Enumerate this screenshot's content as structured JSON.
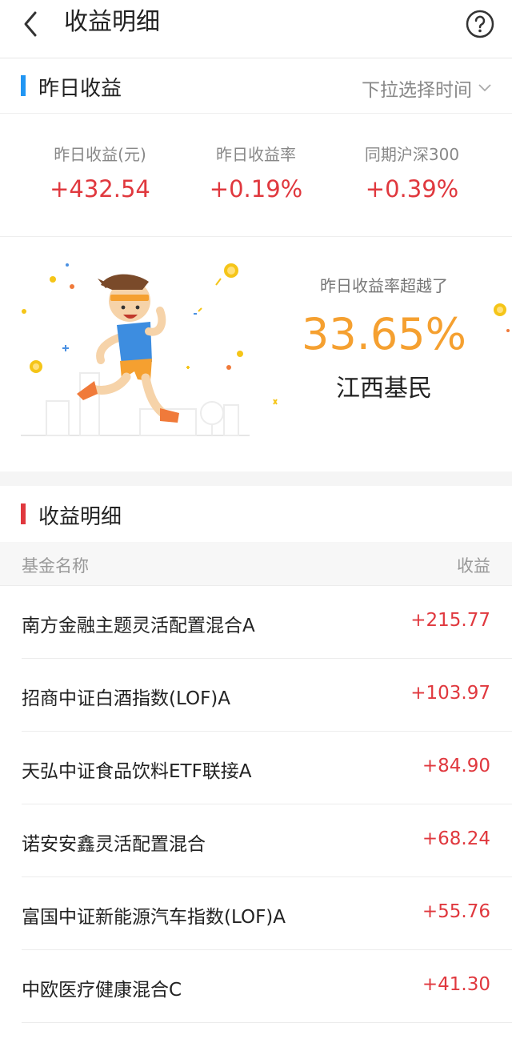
{
  "header": {
    "title": "收益明细"
  },
  "yesterday_section": {
    "title": "昨日收益",
    "dropdown_label": "下拉选择时间",
    "accent_color": "#2196f3"
  },
  "stats": [
    {
      "label": "昨日收益(元)",
      "value": "+432.54"
    },
    {
      "label": "昨日收益率",
      "value": "+0.19%"
    },
    {
      "label": "同期沪深300",
      "value": "+0.39%"
    }
  ],
  "beat": {
    "label": "昨日收益率超越了",
    "value": "33.65%",
    "region": "江西基民"
  },
  "detail_section": {
    "title": "收益明细",
    "accent_color": "#e0383e"
  },
  "table": {
    "col_name": "基金名称",
    "col_profit": "收益",
    "rows": [
      {
        "name": "南方金融主题灵活配置混合A",
        "profit": "+215.77"
      },
      {
        "name": "招商中证白酒指数(LOF)A",
        "profit": "+103.97"
      },
      {
        "name": "天弘中证食品饮料ETF联接A",
        "profit": "+84.90"
      },
      {
        "name": "诺安安鑫灵活配置混合",
        "profit": "+68.24"
      },
      {
        "name": "富国中证新能源汽车指数(LOF)A",
        "profit": "+55.76"
      },
      {
        "name": "中欧医疗健康混合C",
        "profit": "+41.30"
      }
    ]
  },
  "colors": {
    "positive": "#e0383e",
    "highlight": "#f5a030"
  },
  "icons": [
    "back-arrow-icon",
    "help-circle-icon",
    "chevron-down-icon",
    "runner-illustration"
  ]
}
